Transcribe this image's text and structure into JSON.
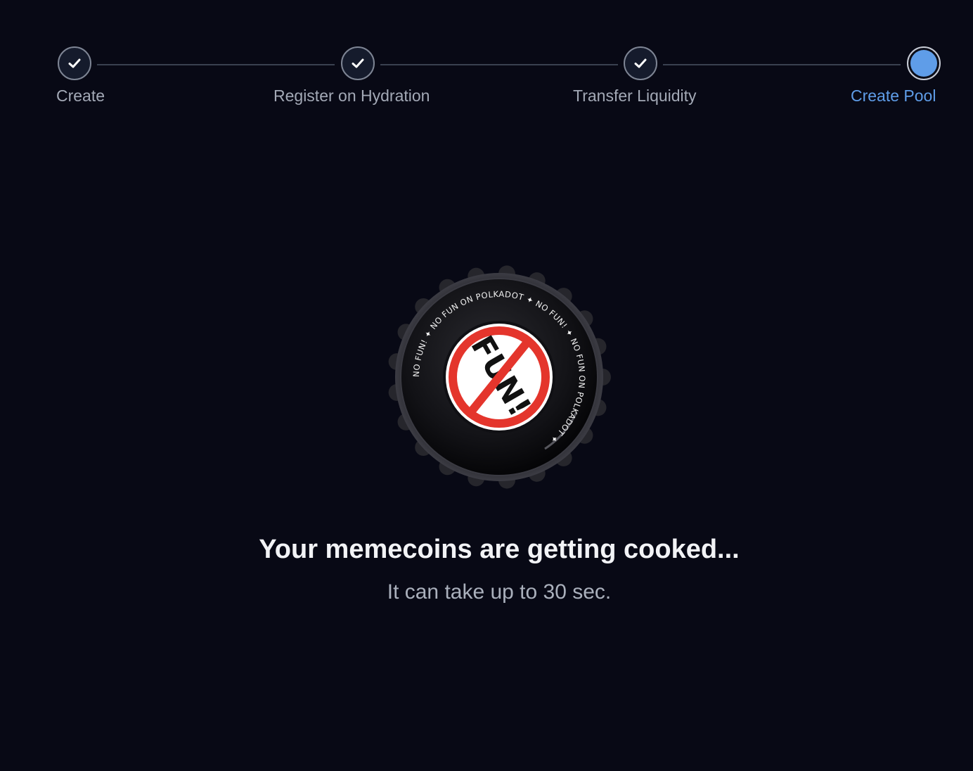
{
  "stepper": {
    "steps": [
      {
        "label": "Create",
        "status": "completed"
      },
      {
        "label": "Register on Hydration",
        "status": "completed"
      },
      {
        "label": "Transfer Liquidity",
        "status": "completed"
      },
      {
        "label": "Create Pool",
        "status": "current"
      }
    ],
    "colors": {
      "completed_label": "#a3a9b6",
      "current_label": "#5f9de8",
      "check": "#ffffff",
      "connector": "#3a4150"
    }
  },
  "loader": {
    "image": "bottle-cap-no-fun-icon",
    "cap_ring_text": "NO FUN! ✦ NO FUN ON POLKADOT ✦ NO FUN! ✦ NO FUN ON POLKADOT ✦",
    "cap_center_text": "FUN!",
    "headline": "Your memecoins are getting cooked...",
    "subline": "It can take up to 30 sec."
  },
  "colors": {
    "background": "#080915",
    "accent": "#5f9de8",
    "no_sign_red": "#e4352c"
  }
}
